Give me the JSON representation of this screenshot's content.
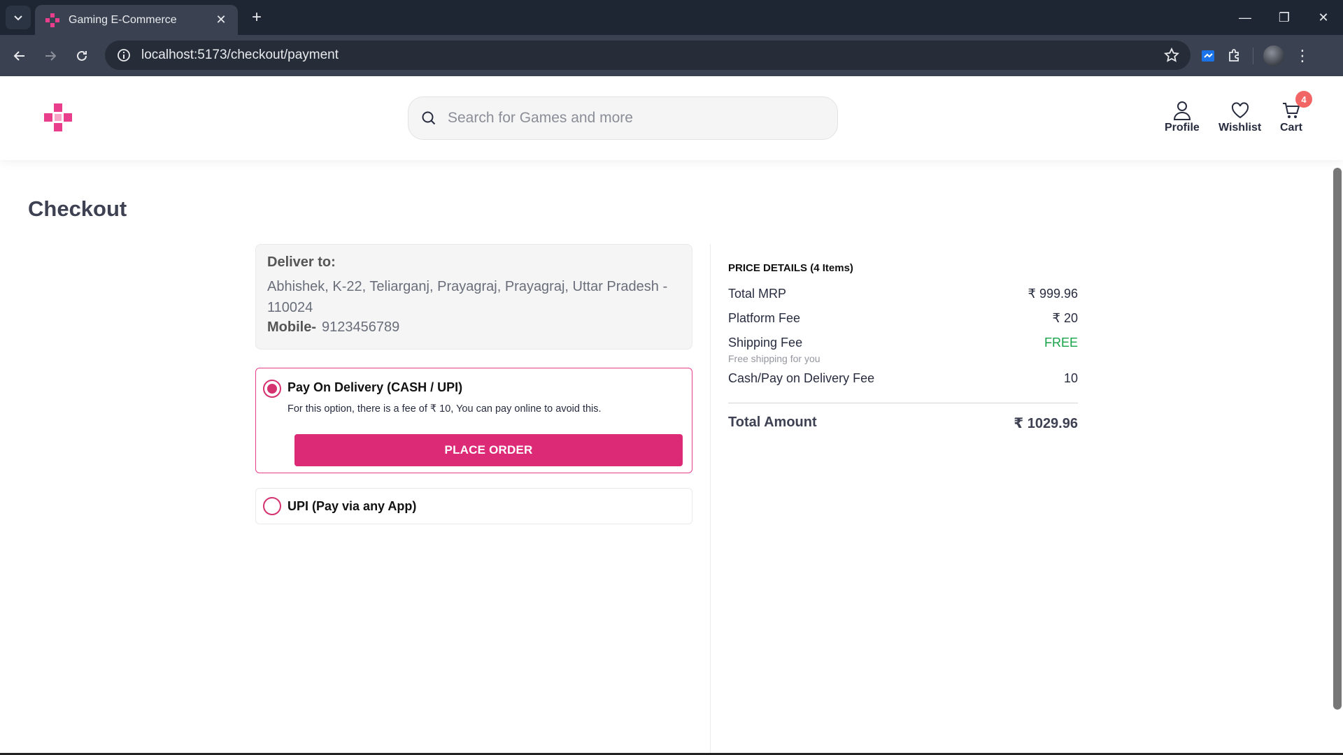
{
  "browser": {
    "tab_title": "Gaming E-Commerce",
    "url": "localhost:5173/checkout/payment"
  },
  "header": {
    "search_placeholder": "Search for Games and more",
    "profile_label": "Profile",
    "wishlist_label": "Wishlist",
    "cart_label": "Cart",
    "cart_count": "4",
    "brand_color": "#e83e8c"
  },
  "page": {
    "title": "Checkout"
  },
  "delivery": {
    "label": "Deliver to:",
    "address": "Abhishek, K-22, Teliarganj, Prayagraj, Prayagraj, Uttar Pradesh - 110024",
    "mobile_label": "Mobile-",
    "mobile": "9123456789"
  },
  "payment_options": {
    "cod": {
      "label": "Pay On Delivery (CASH / UPI)",
      "note": "For this option, there is a fee of ₹ 10, You can pay online to avoid this.",
      "button": "PLACE ORDER",
      "selected": true
    },
    "upi": {
      "label": "UPI (Pay via any App)",
      "selected": false
    }
  },
  "price_details": {
    "heading": "PRICE DETAILS (4 Items)",
    "total_mrp_label": "Total MRP",
    "total_mrp": "₹ 999.96",
    "platform_fee_label": "Platform Fee",
    "platform_fee": "₹ 20",
    "shipping_fee_label": "Shipping Fee",
    "shipping_fee": "FREE",
    "shipping_note": "Free shipping for you",
    "cod_fee_label": "Cash/Pay on Delivery Fee",
    "cod_fee": "10",
    "total_label": "Total Amount",
    "total": "₹ 1029.96"
  }
}
